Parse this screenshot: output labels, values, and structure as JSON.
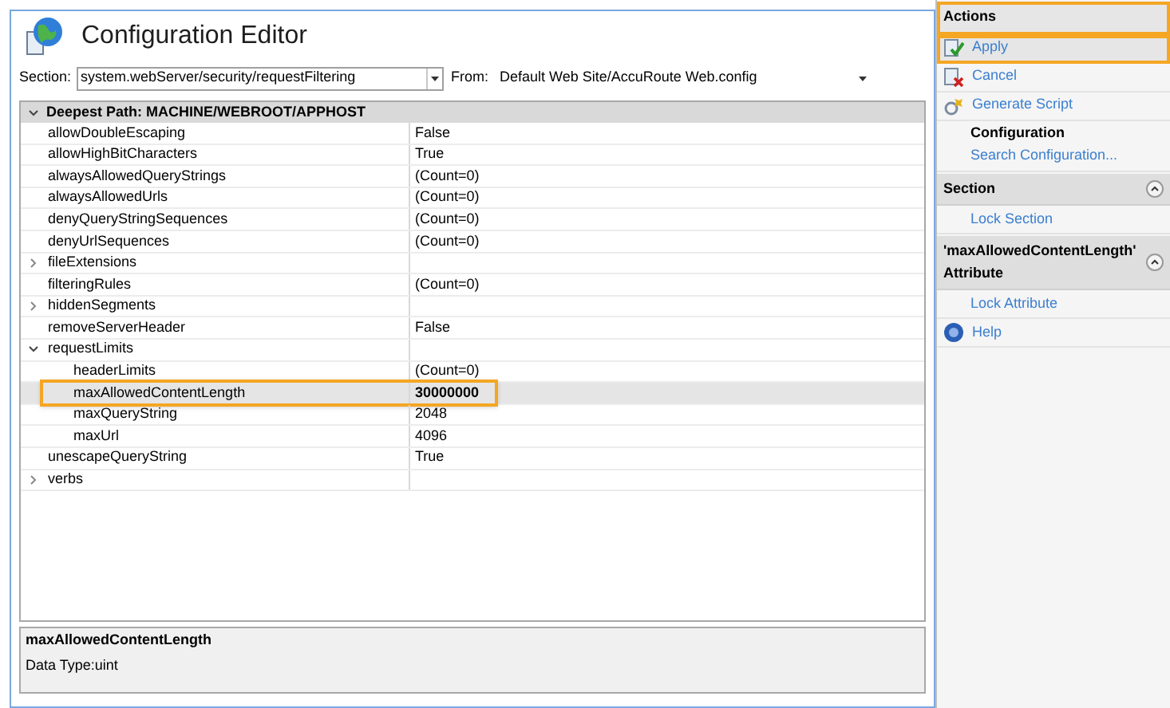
{
  "title": "Configuration Editor",
  "section": {
    "label": "Section:",
    "value": "system.webServer/security/requestFiltering"
  },
  "from": {
    "label": "From:",
    "value": "Default Web Site/AccuRoute Web.config"
  },
  "grid": {
    "header": "Deepest Path: MACHINE/WEBROOT/APPHOST",
    "expanded": true,
    "rows": [
      {
        "kind": "property",
        "name": "allowDoubleEscaping",
        "value": "False",
        "selected": false,
        "highlighted": false
      },
      {
        "kind": "property",
        "name": "allowHighBitCharacters",
        "value": "True",
        "selected": false,
        "highlighted": false
      },
      {
        "kind": "property",
        "name": "alwaysAllowedQueryStrings",
        "value": "(Count=0)",
        "selected": false,
        "highlighted": false
      },
      {
        "kind": "property",
        "name": "alwaysAllowedUrls",
        "value": "(Count=0)",
        "selected": false,
        "highlighted": false
      },
      {
        "kind": "property",
        "name": "denyQueryStringSequences",
        "value": "(Count=0)",
        "selected": false,
        "highlighted": false
      },
      {
        "kind": "property",
        "name": "denyUrlSequences",
        "value": "(Count=0)",
        "selected": false,
        "highlighted": false
      },
      {
        "kind": "group",
        "name": "fileExtensions",
        "expanded": false,
        "selected": false,
        "highlighted": false
      },
      {
        "kind": "property",
        "name": "filteringRules",
        "value": "(Count=0)",
        "selected": false,
        "highlighted": false
      },
      {
        "kind": "group",
        "name": "hiddenSegments",
        "expanded": false,
        "selected": false,
        "highlighted": false
      },
      {
        "kind": "property",
        "name": "removeServerHeader",
        "value": "False",
        "selected": false,
        "highlighted": false
      },
      {
        "kind": "group",
        "name": "requestLimits",
        "expanded": true,
        "selected": false,
        "highlighted": false,
        "children": [
          {
            "kind": "property",
            "name": "headerLimits",
            "value": "(Count=0)",
            "selected": false,
            "highlighted": false
          },
          {
            "kind": "property",
            "name": "maxAllowedContentLength",
            "value": "30000000",
            "selected": true,
            "highlighted": true
          },
          {
            "kind": "property",
            "name": "maxQueryString",
            "value": "2048",
            "selected": false,
            "highlighted": false
          },
          {
            "kind": "property",
            "name": "maxUrl",
            "value": "4096",
            "selected": false,
            "highlighted": false
          }
        ]
      },
      {
        "kind": "property",
        "name": "unescapeQueryString",
        "value": "True",
        "selected": false,
        "highlighted": false
      },
      {
        "kind": "group",
        "name": "verbs",
        "expanded": false,
        "selected": false,
        "highlighted": false
      }
    ]
  },
  "description": {
    "title": "maxAllowedContentLength",
    "text": "Data Type:uint"
  },
  "actions": [
    {
      "kind": "header",
      "label": "Actions",
      "highlighted": true
    },
    {
      "kind": "apply",
      "label": "Apply",
      "highlighted": true
    },
    {
      "kind": "cancel",
      "label": "Cancel",
      "highlighted": false
    },
    {
      "kind": "script",
      "label": "Generate Script",
      "highlighted": false
    },
    {
      "kind": "subheader",
      "label": "Configuration",
      "highlighted": false
    },
    {
      "kind": "link",
      "label": "Search Configuration...",
      "highlighted": false
    },
    {
      "kind": "header",
      "label": "Section",
      "collapsible": true,
      "highlighted": false
    },
    {
      "kind": "link",
      "label": "Lock Section",
      "highlighted": false
    },
    {
      "kind": "header",
      "label": "'maxAllowedContentLength' Attribute",
      "collapsible": true,
      "highlighted": false
    },
    {
      "kind": "link",
      "label": "Lock Attribute",
      "highlighted": false
    },
    {
      "kind": "help",
      "label": "Help",
      "highlighted": false
    }
  ]
}
